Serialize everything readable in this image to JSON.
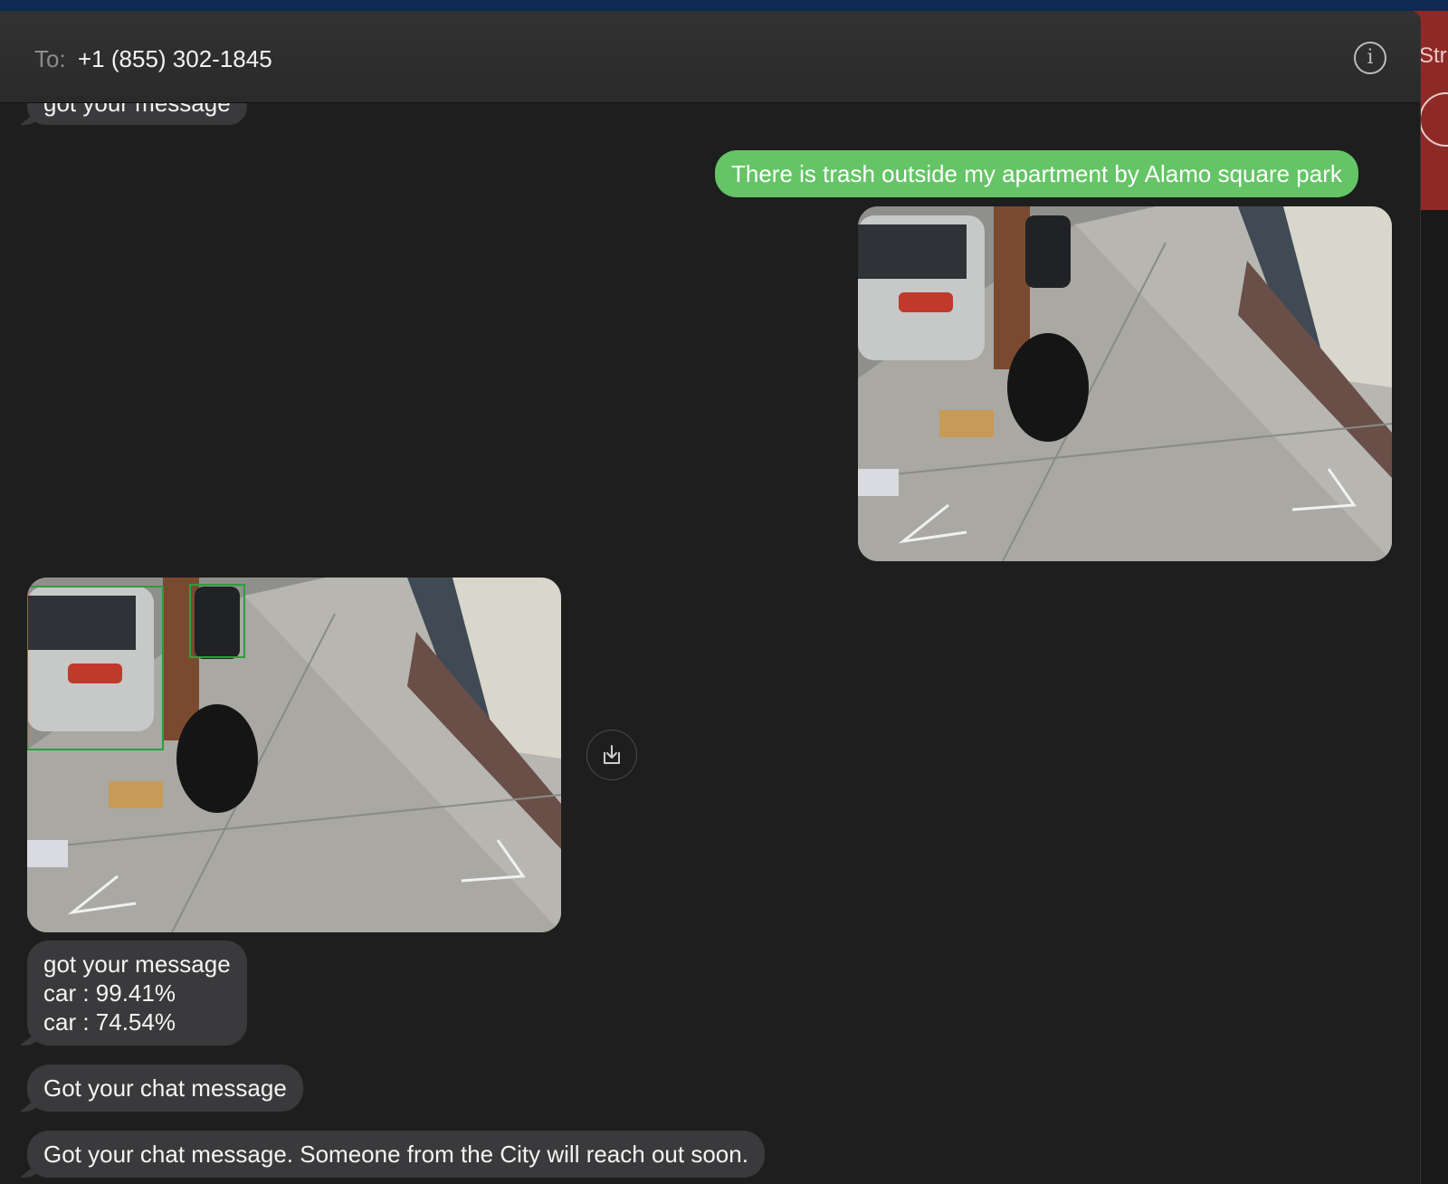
{
  "header": {
    "to_label": "To:",
    "recipient": "+1 (855) 302-1845",
    "info_icon": "info-icon"
  },
  "background_app": {
    "partial_text": "Str"
  },
  "messages": [
    {
      "direction": "incoming",
      "text": "got your message"
    },
    {
      "direction": "outgoing",
      "text": "There is trash outside my apartment by Alamo square park"
    },
    {
      "direction": "outgoing",
      "type": "photo"
    },
    {
      "direction": "incoming",
      "type": "photo"
    },
    {
      "direction": "incoming",
      "text": "got your message\ncar : 99.41%\ncar : 74.54%"
    },
    {
      "direction": "incoming",
      "text": "Got your chat message"
    },
    {
      "direction": "incoming",
      "text": "Got your chat message. Someone from the City will reach out soon."
    }
  ],
  "colors": {
    "outgoing_bubble": "#65c466",
    "incoming_bubble": "#3a3a3c",
    "window_bg": "#1e1e1e"
  },
  "icons": {
    "save": "save-download-icon"
  }
}
